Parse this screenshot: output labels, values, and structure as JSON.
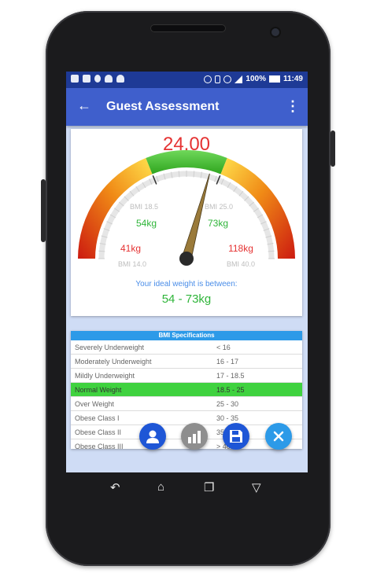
{
  "status_bar": {
    "battery_percent": "100%",
    "time": "11:49"
  },
  "app_bar": {
    "title": "Guest Assessment"
  },
  "gauge": {
    "bmi_value": "24.00",
    "value": 24.0,
    "min_bmi": 14.0,
    "max_bmi": 40.0,
    "labels": {
      "bmi_min": "BMI 14.0",
      "bmi_max": "BMI 40.0",
      "bmi_low": "BMI 18.5",
      "bmi_high": "BMI 25.0",
      "kg_min": "41kg",
      "kg_max": "118kg",
      "kg_low": "54kg",
      "kg_high": "73kg"
    },
    "colors": {
      "green": "#3fbf2a",
      "red": "#cc1a10",
      "orange": "#f29a16",
      "yellow": "#ffe14d"
    }
  },
  "ideal": {
    "label": "Your ideal weight is between:",
    "range": "54 - 73kg"
  },
  "specs": {
    "header": "BMI Specifications",
    "rows": [
      {
        "category": "Severely Underweight",
        "range": "< 16"
      },
      {
        "category": "Moderately Underweight",
        "range": "16 - 17"
      },
      {
        "category": "Mildly Underweight",
        "range": "17 - 18.5"
      },
      {
        "category": "Normal Weight",
        "range": "18.5 - 25"
      },
      {
        "category": "Over Weight",
        "range": "25 - 30"
      },
      {
        "category": "Obese Class I",
        "range": "30 - 35"
      },
      {
        "category": "Obese Class II",
        "range": "35 - 40"
      },
      {
        "category": "Obese Class III",
        "range": "> 40"
      }
    ],
    "highlight_index": 3,
    "highlight_color": "#3fd23f"
  },
  "fabs": {
    "user_color": "#1e56d6",
    "chart_color": "#8e8e8e",
    "save_color": "#1e56d6",
    "close_color": "#2c9ae8"
  }
}
